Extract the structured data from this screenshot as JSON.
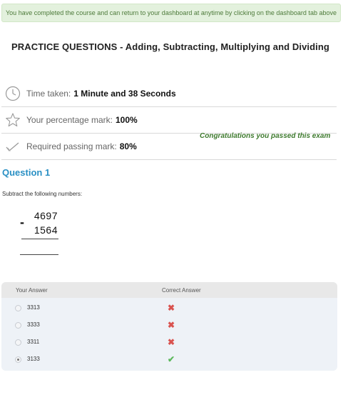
{
  "notice": "You have completed the course and can return to your dashboard at anytime by clicking on the dashboard tab above",
  "title": "PRACTICE QUESTIONS - Adding, Subtracting, Multiplying and Dividing",
  "results": {
    "time_label": "Time taken:",
    "time_value": "1 Minute and 38 Seconds",
    "mark_label": "Your percentage mark:",
    "mark_value": "100%",
    "pass_label": "Required passing mark:",
    "pass_value": "80%",
    "congrats": "Congratulations you passed this exam"
  },
  "question": {
    "title": "Question 1",
    "text": "Subtract the following numbers:",
    "operator": "-",
    "top_number": "4697",
    "bottom_number": "1564"
  },
  "answers": {
    "col_your": "Your Answer",
    "col_correct": "Correct Answer",
    "rows": [
      {
        "value": "3313",
        "selected": false,
        "correct": false,
        "mark": "✖"
      },
      {
        "value": "3333",
        "selected": false,
        "correct": false,
        "mark": "✖"
      },
      {
        "value": "3311",
        "selected": false,
        "correct": false,
        "mark": "✖"
      },
      {
        "value": "3133",
        "selected": true,
        "correct": true,
        "mark": "✔"
      }
    ]
  },
  "icons": {
    "time": "clock-icon",
    "mark": "star-icon",
    "pass": "checkmark-icon"
  },
  "colors": {
    "notice_bg": "#e3f1dd",
    "notice_text": "#4d7a3a",
    "question_title": "#2a90c4",
    "congrats": "#3e7a2e",
    "wrong": "#d9534f",
    "right": "#5cb85c"
  }
}
